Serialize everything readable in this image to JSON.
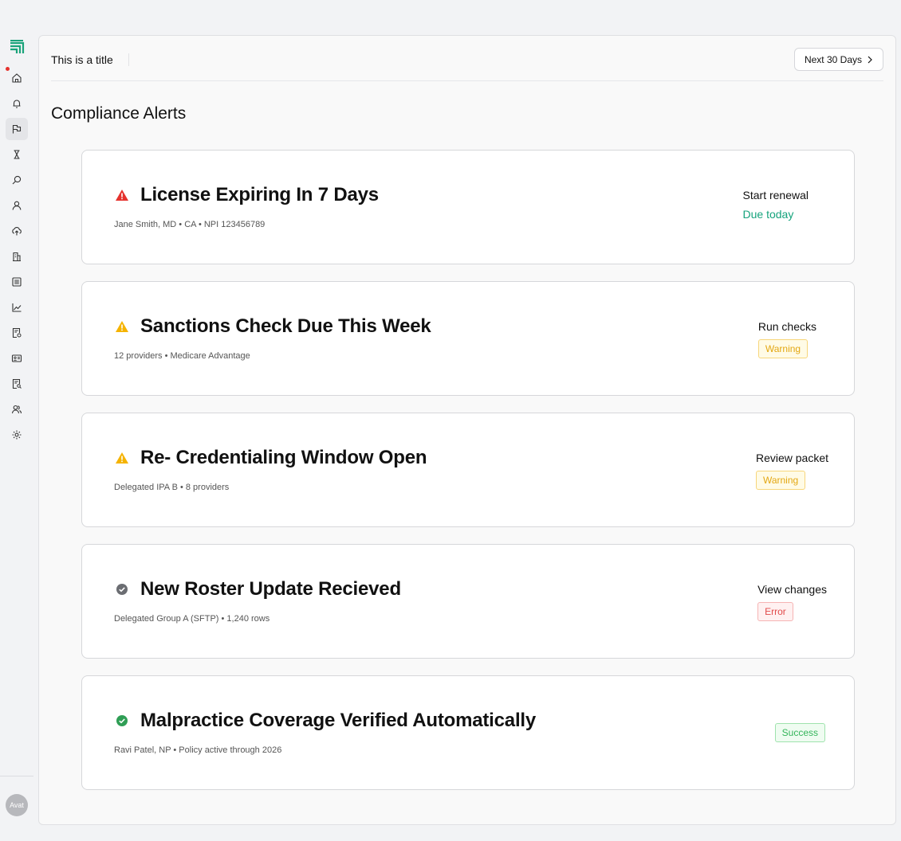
{
  "sidebar": {
    "avatar_label": "Avat",
    "items": [
      {
        "icon": "home-icon",
        "active": false
      },
      {
        "icon": "bell-icon",
        "active": false
      },
      {
        "icon": "flag-icon",
        "active": true
      },
      {
        "icon": "hourglass-icon",
        "active": false
      },
      {
        "icon": "search-icon",
        "active": false
      },
      {
        "icon": "user-icon",
        "active": false
      },
      {
        "icon": "cloud-upload-icon",
        "active": false
      },
      {
        "icon": "building-icon",
        "active": false
      },
      {
        "icon": "list-icon",
        "active": false
      },
      {
        "icon": "chart-icon",
        "active": false
      },
      {
        "icon": "document-settings-icon",
        "active": false
      },
      {
        "icon": "id-card-icon",
        "active": false
      },
      {
        "icon": "document-search-icon",
        "active": false
      },
      {
        "icon": "users-icon",
        "active": false
      },
      {
        "icon": "gear-icon",
        "active": false
      }
    ]
  },
  "header": {
    "title": "This is a title",
    "range_button": "Next 30 Days"
  },
  "page_title": "Compliance Alerts",
  "colors": {
    "brand": "#1aa37a",
    "danger": "#e5322d",
    "warning": "#f5b301",
    "neutral": "#6b6d72",
    "success": "#2f9e55"
  },
  "alerts": [
    {
      "status": "danger",
      "title": "License Expiring In 7 Days",
      "subtitle": "Jane Smith, MD • CA • NPI 123456789",
      "action": "Start renewal",
      "tag": "Due today",
      "tag_kind": "due"
    },
    {
      "status": "warning",
      "title": "Sanctions Check Due This Week",
      "subtitle": "12 providers • Medicare Advantage",
      "action": "Run checks",
      "tag": "Warning",
      "tag_kind": "warning"
    },
    {
      "status": "warning",
      "title": "Re- Credentialing Window Open",
      "subtitle": "Delegated IPA B • 8 providers",
      "action": "Review packet",
      "tag": "Warning",
      "tag_kind": "warning"
    },
    {
      "status": "neutral",
      "title": "New Roster Update Recieved",
      "subtitle": "Delegated Group A (SFTP) • 1,240 rows",
      "action": "View changes",
      "tag": "Error",
      "tag_kind": "error"
    },
    {
      "status": "success",
      "title": "Malpractice Coverage Verified Automatically",
      "subtitle": "Ravi Patel, NP • Policy active through 2026",
      "action": "",
      "tag": "Success",
      "tag_kind": "success"
    }
  ]
}
